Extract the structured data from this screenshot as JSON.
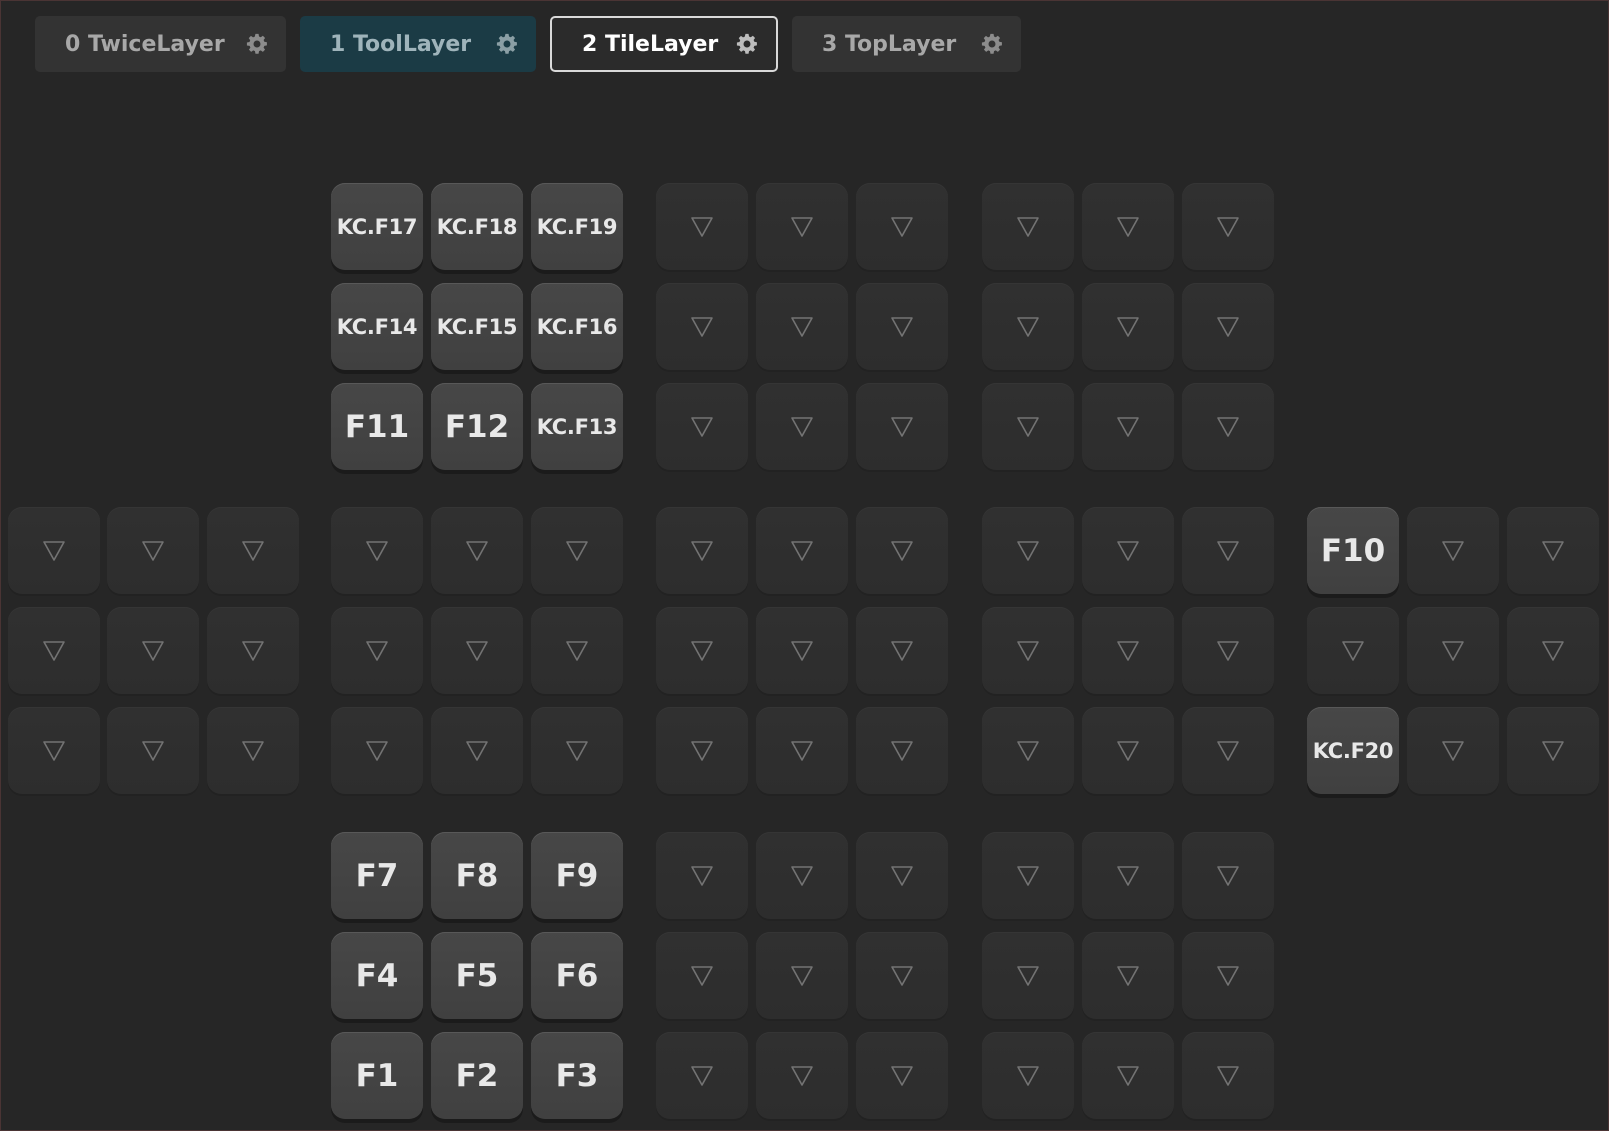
{
  "tabs": [
    {
      "label": "0 TwiceLayer",
      "selected": false,
      "icon": "gear-icon"
    },
    {
      "label": "1 ToolLayer",
      "selected": false,
      "icon": "gear-icon"
    },
    {
      "label": "2 TileLayer",
      "selected": true,
      "icon": "gear-icon"
    },
    {
      "label": "3 TopLayer",
      "selected": false,
      "icon": "gear-icon"
    }
  ],
  "keys": {
    "kc_f17": "KC.F17",
    "kc_f18": "KC.F18",
    "kc_f19": "KC.F19",
    "kc_f14": "KC.F14",
    "kc_f15": "KC.F15",
    "kc_f16": "KC.F16",
    "f11": "F11",
    "f12": "F12",
    "kc_f13": "KC.F13",
    "f10": "F10",
    "kc_f20": "KC.F20",
    "f7": "F7",
    "f8": "F8",
    "f9": "F9",
    "f4": "F4",
    "f5": "F5",
    "f6": "F6",
    "f1": "F1",
    "f2": "F2",
    "f3": "F3"
  },
  "empty_key_icon": "transparent-triangle-icon",
  "colors": {
    "background": "#262626",
    "tab_selected_border": "#d9d9d9",
    "tab_tool_bg": "#1b3b45",
    "key_active": "#444444",
    "key_empty": "#2f2f2f"
  }
}
